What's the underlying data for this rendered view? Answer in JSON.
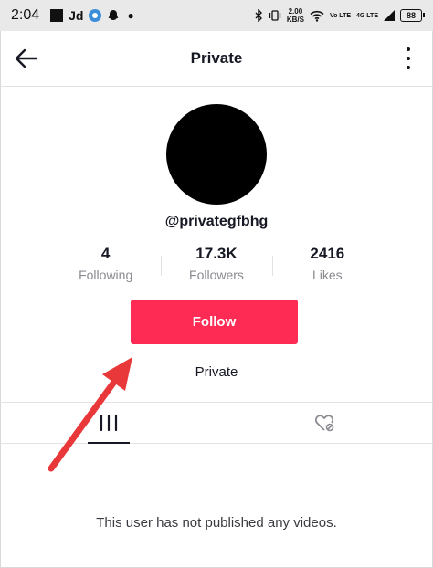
{
  "status_bar": {
    "time": "2:04",
    "app_badge": "Jd",
    "net_speed": "2.00",
    "net_speed_unit": "KB/S",
    "volte_tag": "Vo LTE",
    "network_tag": "4G LTE",
    "battery": "88"
  },
  "header": {
    "title": "Private"
  },
  "profile": {
    "username": "@privategfbhg",
    "stats": [
      {
        "value": "4",
        "label": "Following"
      },
      {
        "value": "17.3K",
        "label": "Followers"
      },
      {
        "value": "2416",
        "label": "Likes"
      }
    ],
    "follow_label": "Follow",
    "account_status": "Private"
  },
  "content": {
    "empty_message": "This user has not published any videos."
  },
  "colors": {
    "accent": "#fe2c55",
    "annotation_arrow": "#e8383a"
  },
  "icons": [
    "back-arrow-icon",
    "more-options-icon",
    "video-grid-icon",
    "liked-heart-icon"
  ]
}
